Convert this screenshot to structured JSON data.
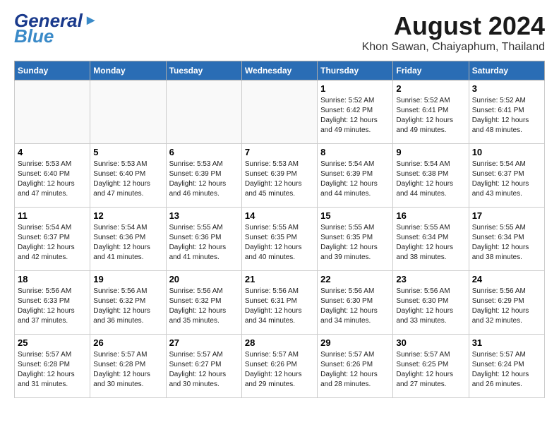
{
  "header": {
    "logo_general": "General",
    "logo_blue": "Blue",
    "month_year": "August 2024",
    "location": "Khon Sawan, Chaiyaphum, Thailand"
  },
  "weekdays": [
    "Sunday",
    "Monday",
    "Tuesday",
    "Wednesday",
    "Thursday",
    "Friday",
    "Saturday"
  ],
  "weeks": [
    [
      {
        "day": "",
        "info": ""
      },
      {
        "day": "",
        "info": ""
      },
      {
        "day": "",
        "info": ""
      },
      {
        "day": "",
        "info": ""
      },
      {
        "day": "1",
        "info": "Sunrise: 5:52 AM\nSunset: 6:42 PM\nDaylight: 12 hours\nand 49 minutes."
      },
      {
        "day": "2",
        "info": "Sunrise: 5:52 AM\nSunset: 6:41 PM\nDaylight: 12 hours\nand 49 minutes."
      },
      {
        "day": "3",
        "info": "Sunrise: 5:52 AM\nSunset: 6:41 PM\nDaylight: 12 hours\nand 48 minutes."
      }
    ],
    [
      {
        "day": "4",
        "info": "Sunrise: 5:53 AM\nSunset: 6:40 PM\nDaylight: 12 hours\nand 47 minutes."
      },
      {
        "day": "5",
        "info": "Sunrise: 5:53 AM\nSunset: 6:40 PM\nDaylight: 12 hours\nand 47 minutes."
      },
      {
        "day": "6",
        "info": "Sunrise: 5:53 AM\nSunset: 6:39 PM\nDaylight: 12 hours\nand 46 minutes."
      },
      {
        "day": "7",
        "info": "Sunrise: 5:53 AM\nSunset: 6:39 PM\nDaylight: 12 hours\nand 45 minutes."
      },
      {
        "day": "8",
        "info": "Sunrise: 5:54 AM\nSunset: 6:39 PM\nDaylight: 12 hours\nand 44 minutes."
      },
      {
        "day": "9",
        "info": "Sunrise: 5:54 AM\nSunset: 6:38 PM\nDaylight: 12 hours\nand 44 minutes."
      },
      {
        "day": "10",
        "info": "Sunrise: 5:54 AM\nSunset: 6:37 PM\nDaylight: 12 hours\nand 43 minutes."
      }
    ],
    [
      {
        "day": "11",
        "info": "Sunrise: 5:54 AM\nSunset: 6:37 PM\nDaylight: 12 hours\nand 42 minutes."
      },
      {
        "day": "12",
        "info": "Sunrise: 5:54 AM\nSunset: 6:36 PM\nDaylight: 12 hours\nand 41 minutes."
      },
      {
        "day": "13",
        "info": "Sunrise: 5:55 AM\nSunset: 6:36 PM\nDaylight: 12 hours\nand 41 minutes."
      },
      {
        "day": "14",
        "info": "Sunrise: 5:55 AM\nSunset: 6:35 PM\nDaylight: 12 hours\nand 40 minutes."
      },
      {
        "day": "15",
        "info": "Sunrise: 5:55 AM\nSunset: 6:35 PM\nDaylight: 12 hours\nand 39 minutes."
      },
      {
        "day": "16",
        "info": "Sunrise: 5:55 AM\nSunset: 6:34 PM\nDaylight: 12 hours\nand 38 minutes."
      },
      {
        "day": "17",
        "info": "Sunrise: 5:55 AM\nSunset: 6:34 PM\nDaylight: 12 hours\nand 38 minutes."
      }
    ],
    [
      {
        "day": "18",
        "info": "Sunrise: 5:56 AM\nSunset: 6:33 PM\nDaylight: 12 hours\nand 37 minutes."
      },
      {
        "day": "19",
        "info": "Sunrise: 5:56 AM\nSunset: 6:32 PM\nDaylight: 12 hours\nand 36 minutes."
      },
      {
        "day": "20",
        "info": "Sunrise: 5:56 AM\nSunset: 6:32 PM\nDaylight: 12 hours\nand 35 minutes."
      },
      {
        "day": "21",
        "info": "Sunrise: 5:56 AM\nSunset: 6:31 PM\nDaylight: 12 hours\nand 34 minutes."
      },
      {
        "day": "22",
        "info": "Sunrise: 5:56 AM\nSunset: 6:30 PM\nDaylight: 12 hours\nand 34 minutes."
      },
      {
        "day": "23",
        "info": "Sunrise: 5:56 AM\nSunset: 6:30 PM\nDaylight: 12 hours\nand 33 minutes."
      },
      {
        "day": "24",
        "info": "Sunrise: 5:56 AM\nSunset: 6:29 PM\nDaylight: 12 hours\nand 32 minutes."
      }
    ],
    [
      {
        "day": "25",
        "info": "Sunrise: 5:57 AM\nSunset: 6:28 PM\nDaylight: 12 hours\nand 31 minutes."
      },
      {
        "day": "26",
        "info": "Sunrise: 5:57 AM\nSunset: 6:28 PM\nDaylight: 12 hours\nand 30 minutes."
      },
      {
        "day": "27",
        "info": "Sunrise: 5:57 AM\nSunset: 6:27 PM\nDaylight: 12 hours\nand 30 minutes."
      },
      {
        "day": "28",
        "info": "Sunrise: 5:57 AM\nSunset: 6:26 PM\nDaylight: 12 hours\nand 29 minutes."
      },
      {
        "day": "29",
        "info": "Sunrise: 5:57 AM\nSunset: 6:26 PM\nDaylight: 12 hours\nand 28 minutes."
      },
      {
        "day": "30",
        "info": "Sunrise: 5:57 AM\nSunset: 6:25 PM\nDaylight: 12 hours\nand 27 minutes."
      },
      {
        "day": "31",
        "info": "Sunrise: 5:57 AM\nSunset: 6:24 PM\nDaylight: 12 hours\nand 26 minutes."
      }
    ]
  ]
}
